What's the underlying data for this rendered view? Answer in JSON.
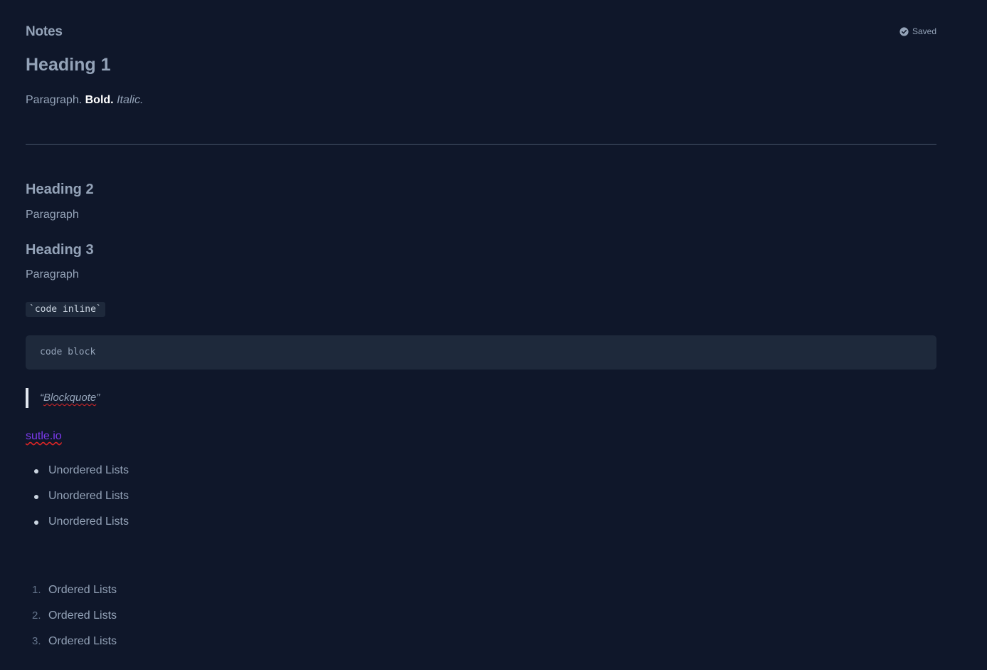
{
  "header": {
    "app_title": "Notes",
    "save_status": "Saved",
    "save_icon": "check-circle-icon"
  },
  "document": {
    "heading1": "Heading 1",
    "paragraph1": {
      "plain": "Paragraph.",
      "bold": "Bold.",
      "italic": "Italic."
    },
    "heading2": "Heading 2",
    "paragraph2": "Paragraph",
    "heading3": "Heading 3",
    "paragraph3": "Paragraph",
    "code_inline": "`code inline`",
    "code_block": "code block",
    "blockquote": {
      "open_quote": "“",
      "text": "Blockquote",
      "close_quote": "”"
    },
    "link": "sutle.io",
    "unordered_list": [
      "Unordered Lists",
      "Unordered Lists",
      "Unordered Lists"
    ],
    "ordered_list": [
      {
        "num": "1.",
        "text": "Ordered Lists"
      },
      {
        "num": "2.",
        "text": "Ordered Lists"
      },
      {
        "num": "3.",
        "text": "Ordered Lists"
      }
    ]
  },
  "colors": {
    "background": "#0f172a",
    "text": "#94a3b8",
    "link": "#7c3aed",
    "spellcheck": "#dc2626",
    "code_bg": "#1e293b"
  }
}
